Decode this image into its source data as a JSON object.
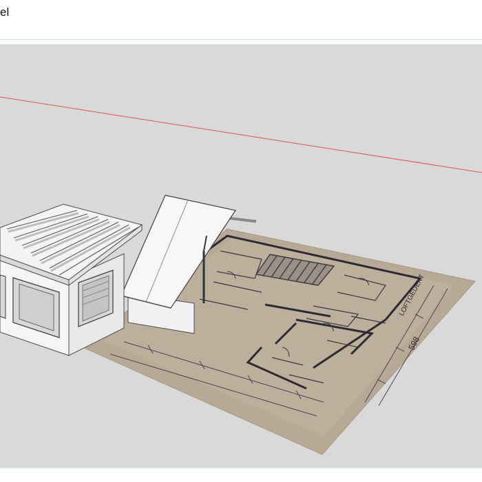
{
  "window": {
    "title": "el"
  },
  "viewport": {
    "background_color": "#d9d9d9",
    "axis_color": "#e05050",
    "floorplan_paper_color": "#b8aa98",
    "model_wall_color": "#f4f4f4"
  },
  "floorplan": {
    "dimension_label": "598",
    "side_label": "LOFTGEDEKT"
  }
}
